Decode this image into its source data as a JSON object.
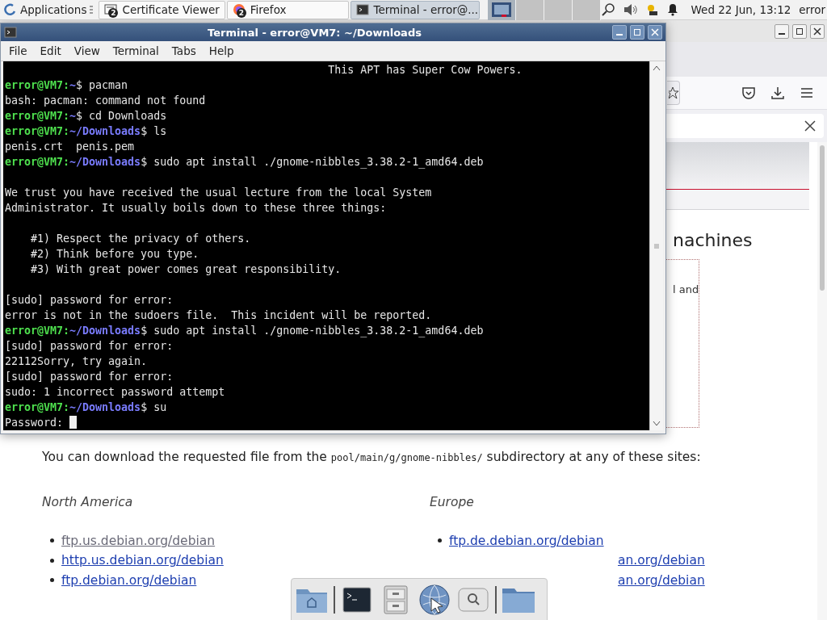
{
  "panel": {
    "applications": "Applications",
    "tasks": [
      {
        "kind": "certificate",
        "label": "Certificate Viewer",
        "badge": "2",
        "selected": false
      },
      {
        "kind": "browser",
        "label": "Firefox",
        "badge": "2",
        "selected": false
      },
      {
        "kind": "terminal",
        "label": "Terminal - error@...",
        "selected": true
      }
    ],
    "workspaces": [
      {
        "selected": true
      },
      {
        "selected": false
      },
      {
        "selected": false
      },
      {
        "selected": false
      }
    ],
    "clock": "Wed 22 Jun, 13:12",
    "user": "error"
  },
  "browser": {
    "heading": "nachines",
    "box_text": "l and",
    "paragraph": {
      "before": "You can download the requested file from the ",
      "code": "pool/main/g/gnome-nibbles/",
      "after": " subdirectory at any of these sites:"
    },
    "regions": [
      {
        "title": "North America",
        "links": [
          {
            "text": "ftp.us.debian.org/debian",
            "visited": true
          },
          {
            "text": "http.us.debian.org/debian",
            "visited": false
          },
          {
            "text": "ftp.debian.org/debian",
            "visited": false
          }
        ]
      },
      {
        "title": "Europe",
        "links": [
          {
            "text": "ftp.de.debian.org/debian",
            "visited": false,
            "covered": false
          },
          {
            "text": "an.org/debian",
            "visited": false,
            "covered": true
          },
          {
            "text": "an.org/debian",
            "visited": false,
            "covered": true
          }
        ]
      }
    ]
  },
  "terminal": {
    "title": "Terminal - error@VM7: ~/Downloads",
    "menu": [
      "File",
      "Edit",
      "View",
      "Terminal",
      "Tabs",
      "Help"
    ],
    "lines": [
      {
        "kind": "output",
        "text": "                                                  This APT has Super Cow Powers."
      },
      {
        "kind": "prompt",
        "user": "error@VM7:",
        "path": "~",
        "command": "$ pacman"
      },
      {
        "kind": "output",
        "text": "bash: pacman: command not found"
      },
      {
        "kind": "prompt",
        "user": "error@VM7:",
        "path": "~",
        "command": "$ cd Downloads"
      },
      {
        "kind": "prompt",
        "user": "error@VM7:",
        "path": "~/Downloads",
        "command": "$ ls"
      },
      {
        "kind": "output",
        "text": "penis.crt  penis.pem"
      },
      {
        "kind": "prompt",
        "user": "error@VM7:",
        "path": "~/Downloads",
        "command": "$ sudo apt install ./gnome-nibbles_3.38.2-1_amd64.deb"
      },
      {
        "kind": "blank"
      },
      {
        "kind": "output",
        "text": "We trust you have received the usual lecture from the local System"
      },
      {
        "kind": "output",
        "text": "Administrator. It usually boils down to these three things:"
      },
      {
        "kind": "blank"
      },
      {
        "kind": "output",
        "text": "    #1) Respect the privacy of others."
      },
      {
        "kind": "output",
        "text": "    #2) Think before you type."
      },
      {
        "kind": "output",
        "text": "    #3) With great power comes great responsibility."
      },
      {
        "kind": "blank"
      },
      {
        "kind": "output",
        "text": "[sudo] password for error:"
      },
      {
        "kind": "output",
        "text": "error is not in the sudoers file.  This incident will be reported."
      },
      {
        "kind": "prompt",
        "user": "error@VM7:",
        "path": "~/Downloads",
        "command": "$ sudo apt install ./gnome-nibbles_3.38.2-1_amd64.deb"
      },
      {
        "kind": "output",
        "text": "[sudo] password for error:"
      },
      {
        "kind": "output",
        "text": "22112Sorry, try again."
      },
      {
        "kind": "output",
        "text": "[sudo] password for error:"
      },
      {
        "kind": "output",
        "text": "sudo: 1 incorrect password attempt"
      },
      {
        "kind": "prompt",
        "user": "error@VM7:",
        "path": "~/Downloads",
        "command": "$ su"
      },
      {
        "kind": "output",
        "text": "Password:",
        "cursor": true
      }
    ]
  },
  "dock": [
    {
      "kind": "home-folder"
    },
    {
      "kind": "separator"
    },
    {
      "kind": "terminal"
    },
    {
      "kind": "cabinet"
    },
    {
      "kind": "globe"
    },
    {
      "kind": "search"
    },
    {
      "kind": "separator"
    },
    {
      "kind": "folder"
    }
  ]
}
